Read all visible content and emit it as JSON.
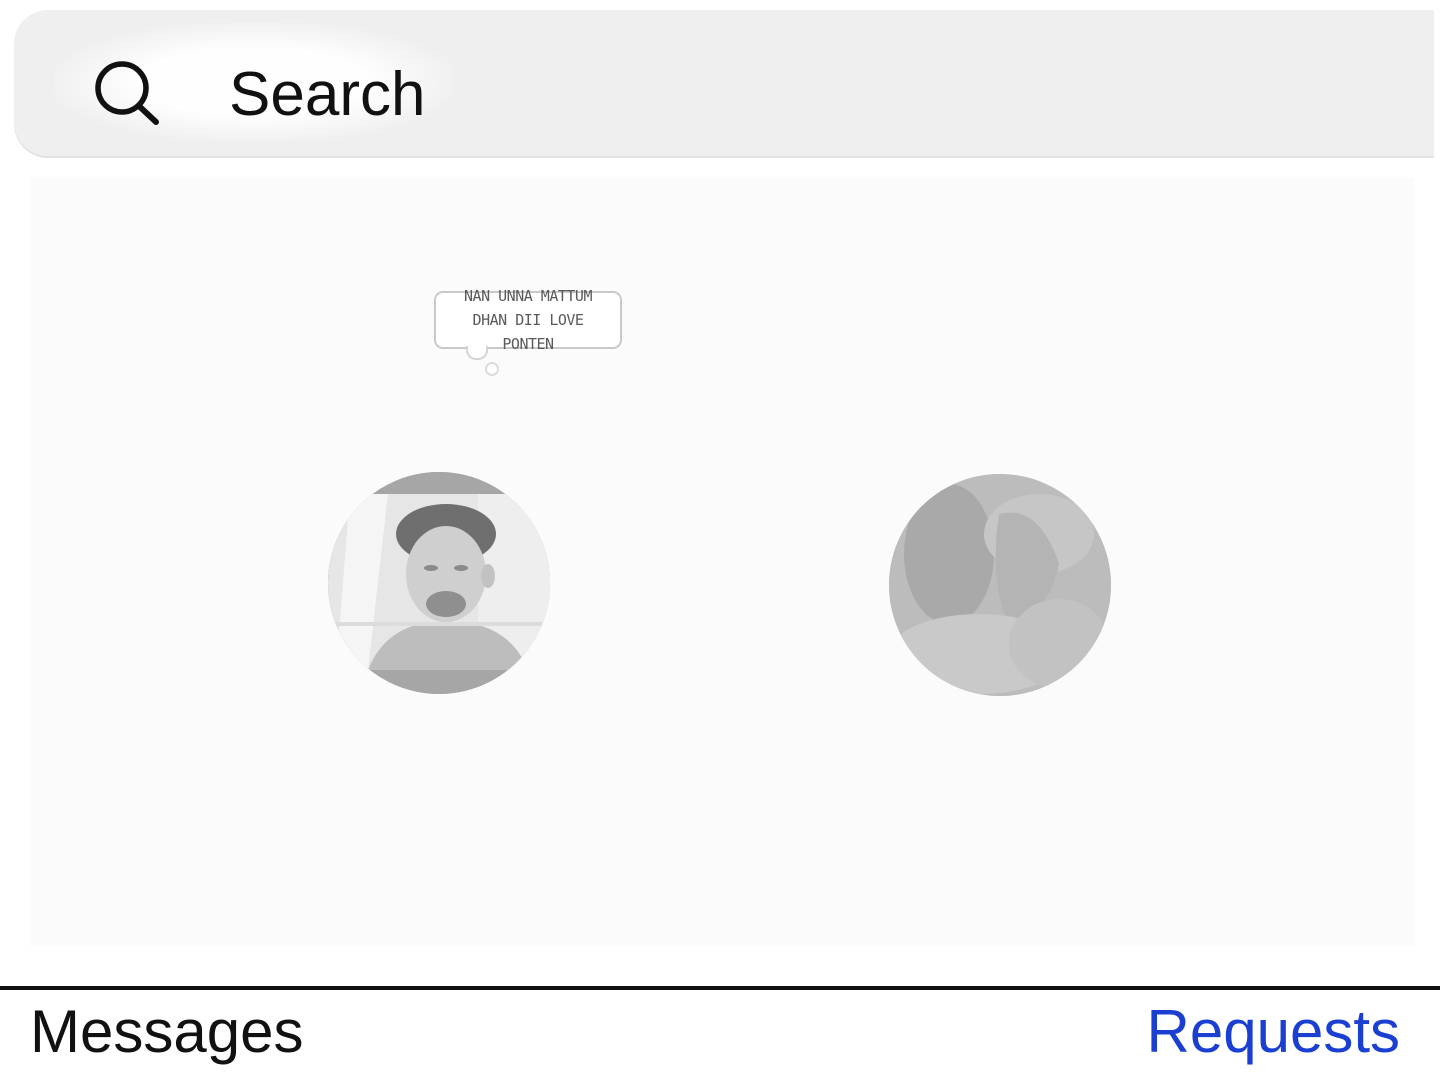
{
  "search": {
    "placeholder": "Search",
    "icon": "search-icon"
  },
  "notes": {
    "items": [
      {
        "note_text": "NAN UNNA MATTUM DHAN DII LOVE PONTEN",
        "avatar": "profile-photo-man"
      },
      {
        "note_text": "",
        "avatar": "profile-photo-blurred"
      }
    ]
  },
  "tabs": {
    "messages_label": "Messages",
    "requests_label": "Requests"
  },
  "colors": {
    "requests_link": "#1a3fd1",
    "search_bg": "#efefef",
    "text": "#111111"
  }
}
